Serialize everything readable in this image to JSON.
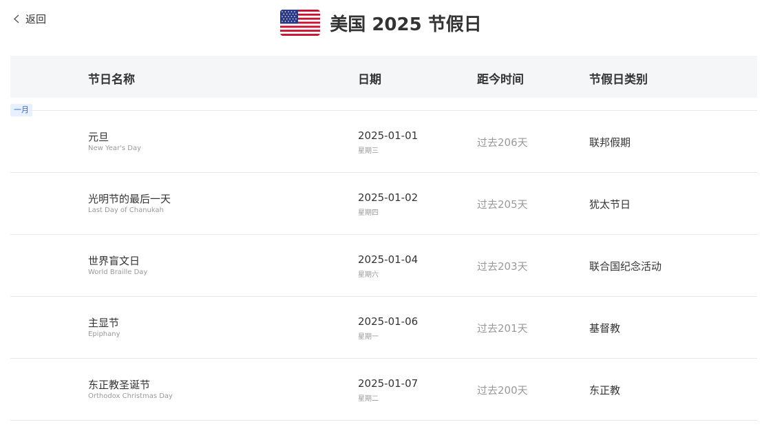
{
  "nav": {
    "back_label": "返回"
  },
  "header": {
    "title": "美国 2025 节假日",
    "flag_icon": "us-flag-icon"
  },
  "table": {
    "columns": [
      "节日名称",
      "日期",
      "距今时间",
      "节假日类别"
    ],
    "month_label": "一月",
    "rows": [
      {
        "name_zh": "元旦",
        "name_en": "New Year's Day",
        "date": "2025-01-01",
        "weekday": "星期三",
        "since": "过去206天",
        "category": "联邦假期"
      },
      {
        "name_zh": "光明节的最后一天",
        "name_en": "Last Day of Chanukah",
        "date": "2025-01-02",
        "weekday": "星期四",
        "since": "过去205天",
        "category": "犹太节日"
      },
      {
        "name_zh": "世界盲文日",
        "name_en": "World Braille Day",
        "date": "2025-01-04",
        "weekday": "星期六",
        "since": "过去203天",
        "category": "联合国纪念活动"
      },
      {
        "name_zh": "主显节",
        "name_en": "Epiphany",
        "date": "2025-01-06",
        "weekday": "星期一",
        "since": "过去201天",
        "category": "基督教"
      },
      {
        "name_zh": "东正教圣诞节",
        "name_en": "Orthodox Christmas Day",
        "date": "2025-01-07",
        "weekday": "星期二",
        "since": "过去200天",
        "category": "东正教"
      }
    ]
  },
  "colors": {
    "header_bg": "#f5f6f8",
    "month_tag_bg": "#e6f0ff",
    "month_tag_text": "#3366cc",
    "muted": "#999999"
  }
}
